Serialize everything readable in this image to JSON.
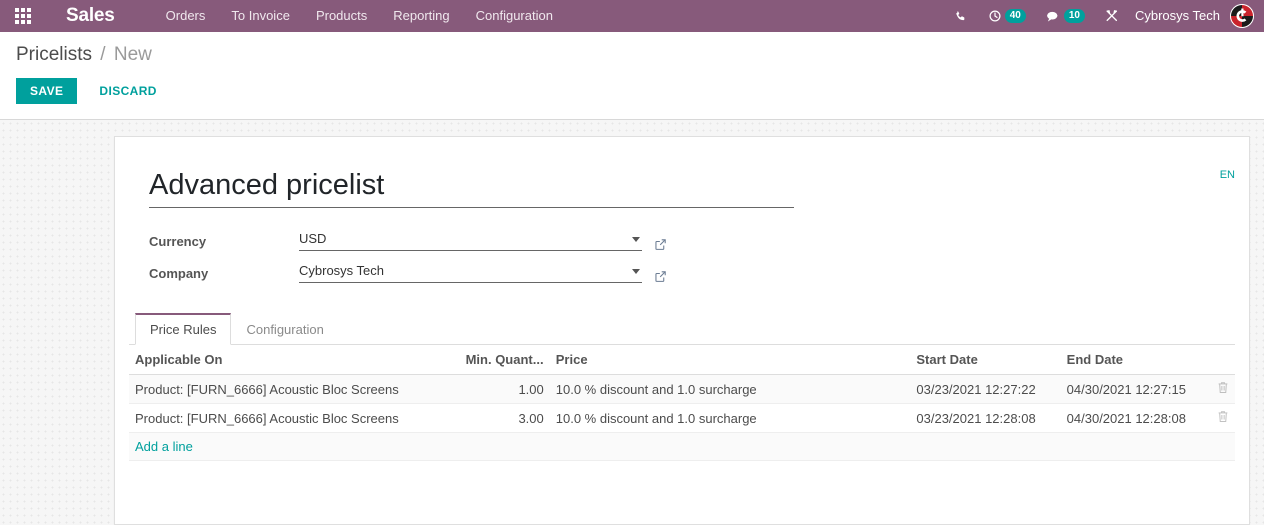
{
  "navbar": {
    "apps_icon": "apps-grid-icon",
    "brand": "Sales",
    "menu": [
      {
        "label": "Orders"
      },
      {
        "label": "To Invoice"
      },
      {
        "label": "Products"
      },
      {
        "label": "Reporting"
      },
      {
        "label": "Configuration"
      }
    ],
    "icons": {
      "phone": "phone-icon",
      "activity": "activity-clock-icon",
      "messages": "chat-bubble-icon",
      "debug": "wrench-screwdriver-icon"
    },
    "activity_count": "40",
    "message_count": "10",
    "user_name": "Cybrosys Tech",
    "avatar": "user-avatar",
    "background_color": "#875A7B",
    "badge_color": "#00A09D"
  },
  "control_panel": {
    "breadcrumb_root": "Pricelists",
    "breadcrumb_separator": "/",
    "breadcrumb_current": "New",
    "save_label": "SAVE",
    "discard_label": "DISCARD",
    "save_color": "#00A09D"
  },
  "form": {
    "title": "Advanced pricelist",
    "language_badge": "EN",
    "fields": [
      {
        "label": "Currency",
        "value": "USD"
      },
      {
        "label": "Company",
        "value": "Cybrosys Tech"
      }
    ]
  },
  "notebook": {
    "tabs": [
      {
        "label": "Price Rules",
        "active": true
      },
      {
        "label": "Configuration",
        "active": false
      }
    ],
    "active_tab_color": "#875A7B"
  },
  "price_rules": {
    "columns": [
      "Applicable On",
      "Min. Quant...",
      "Price",
      "Start Date",
      "End Date"
    ],
    "rows": [
      {
        "applicable_on": "Product: [FURN_6666] Acoustic Bloc Screens",
        "min_quantity": "1.00",
        "price": "10.0 % discount and 1.0 surcharge",
        "start_date": "03/23/2021 12:27:22",
        "end_date": "04/30/2021 12:27:15",
        "delete_icon": "trash-icon"
      },
      {
        "applicable_on": "Product: [FURN_6666] Acoustic Bloc Screens",
        "min_quantity": "3.00",
        "price": "10.0 % discount and 1.0 surcharge",
        "start_date": "03/23/2021 12:28:08",
        "end_date": "04/30/2021 12:28:08",
        "delete_icon": "trash-icon"
      }
    ],
    "add_line_label": "Add a line"
  }
}
